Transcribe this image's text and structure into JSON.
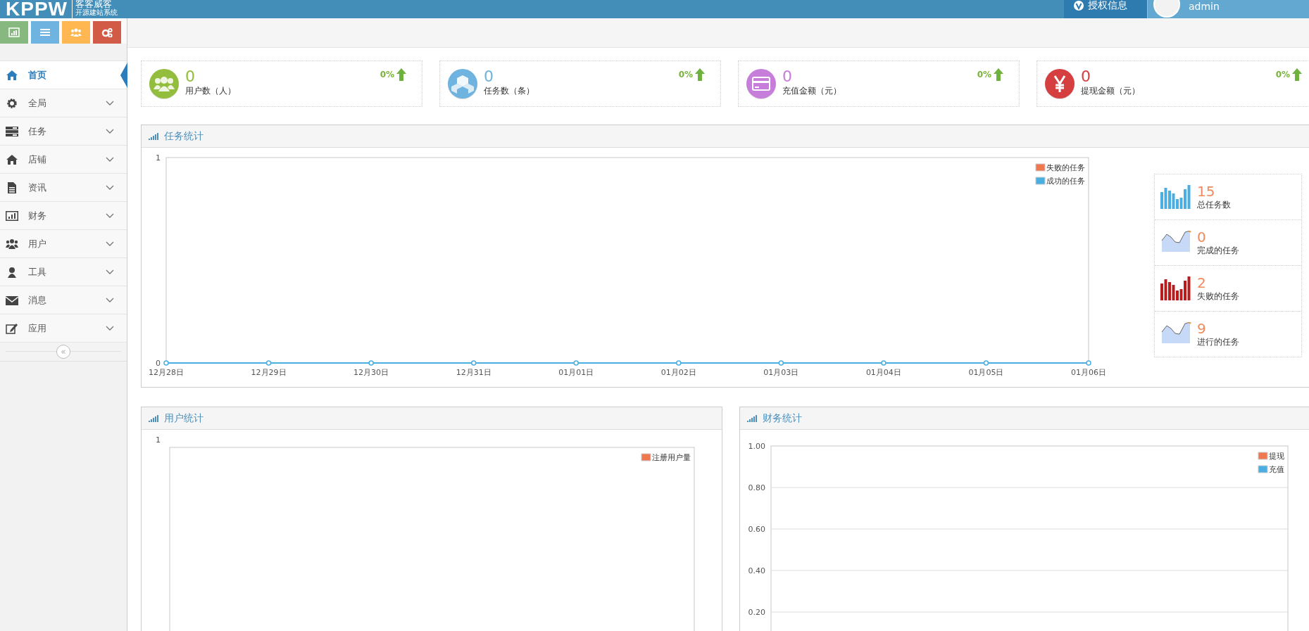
{
  "header": {
    "logo": "KPPW",
    "brand": "客客威客",
    "tagline": "开源建站系统",
    "license_button": "授权信息",
    "user": "admin"
  },
  "shortcuts": [
    {
      "color": "#87b87f"
    },
    {
      "color": "#6fb3e0"
    },
    {
      "color": "#ffb752"
    },
    {
      "color": "#d15b47"
    }
  ],
  "sidebar": {
    "items": [
      {
        "label": "首页",
        "selected": true,
        "has_submenu": false
      },
      {
        "label": "全局",
        "selected": false,
        "has_submenu": true
      },
      {
        "label": "任务",
        "selected": false,
        "has_submenu": true
      },
      {
        "label": "店铺",
        "selected": false,
        "has_submenu": true
      },
      {
        "label": "资讯",
        "selected": false,
        "has_submenu": true
      },
      {
        "label": "财务",
        "selected": false,
        "has_submenu": true
      },
      {
        "label": "用户",
        "selected": false,
        "has_submenu": true
      },
      {
        "label": "工具",
        "selected": false,
        "has_submenu": true
      },
      {
        "label": "消息",
        "selected": false,
        "has_submenu": true
      },
      {
        "label": "应用",
        "selected": false,
        "has_submenu": true
      }
    ],
    "collapse_glyph": "«"
  },
  "stats": [
    {
      "value": "0",
      "label": "用户数（人）",
      "change": "0%",
      "color": "#93bd3c"
    },
    {
      "value": "0",
      "label": "任务数（条）",
      "change": "0%",
      "color": "#6fb3e0"
    },
    {
      "value": "0",
      "label": "充值金额（元）",
      "change": "0%",
      "color": "#c77edb"
    },
    {
      "value": "0",
      "label": "提现金额（元）",
      "change": "0%",
      "color": "#d53f40"
    }
  ],
  "task_panel": {
    "title": "任务统计",
    "chart_data": {
      "type": "line",
      "categories": [
        "12月28日",
        "12月29日",
        "12月30日",
        "12月31日",
        "01月01日",
        "01月02日",
        "01月03日",
        "01月04日",
        "01月05日",
        "01月06日"
      ],
      "series": [
        {
          "name": "失败的任务",
          "color": "#ee7951",
          "values": [
            null,
            null,
            null,
            null,
            null,
            null,
            null,
            null,
            null,
            null
          ]
        },
        {
          "name": "成功的任务",
          "color": "#4aaee0",
          "marker": "circle",
          "values": [
            0,
            0,
            0,
            0,
            0,
            0,
            0,
            0,
            0,
            0
          ]
        }
      ],
      "ylim": [
        0,
        1
      ],
      "yticks": [
        0,
        1
      ],
      "legend": true
    },
    "summary": [
      {
        "kind": "bar",
        "color": "#4aaee0",
        "value": "15",
        "label": "总任务数"
      },
      {
        "kind": "area",
        "color": "#c6d9f7",
        "value": "0",
        "label": "完成的任务"
      },
      {
        "kind": "bar",
        "color": "#b91c1c",
        "value": "2",
        "label": "失败的任务"
      },
      {
        "kind": "area",
        "color": "#c6d9f7",
        "value": "9",
        "label": "进行的任务"
      }
    ]
  },
  "user_panel": {
    "title": "用户统计",
    "y_tick_label": "1",
    "chart_data": {
      "type": "other",
      "series": [
        {
          "name": "注册用户量",
          "color": "#ee7951"
        }
      ],
      "legend": true
    }
  },
  "finance_panel": {
    "title": "财务统计",
    "chart_data": {
      "type": "line",
      "series": [
        {
          "name": "提现",
          "color": "#ee7951"
        },
        {
          "name": "充值",
          "color": "#4aaee0"
        }
      ],
      "ylim": [
        0,
        1
      ],
      "grid": true,
      "legend": true,
      "yticks": [
        {
          "value": 0.2,
          "label": "0.20"
        },
        {
          "value": 0.4,
          "label": "0.40"
        },
        {
          "value": 0.6,
          "label": "0.60"
        },
        {
          "value": 0.8,
          "label": "0.80"
        },
        {
          "value": 1,
          "label": "1.00"
        }
      ]
    }
  }
}
